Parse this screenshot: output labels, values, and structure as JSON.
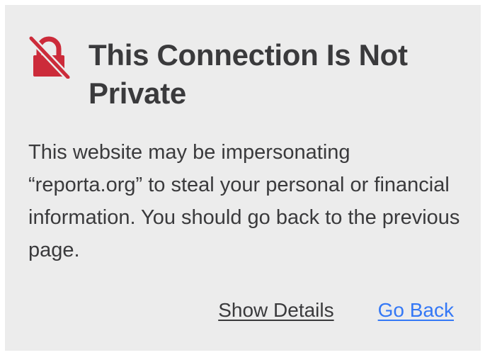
{
  "warning": {
    "icon": "broken-lock-icon",
    "icon_color": "#cc2b3a",
    "title": "This Connection Is Not Private",
    "message": "This website may be impersonating “reporta.org” to steal your personal or financial information. You should go back to the previous page.",
    "show_details_label": "Show Details",
    "go_back_label": "Go Back"
  },
  "colors": {
    "background": "#ececec",
    "text": "#3a3a3c",
    "link": "#3478f6",
    "icon": "#cc2b3a"
  }
}
